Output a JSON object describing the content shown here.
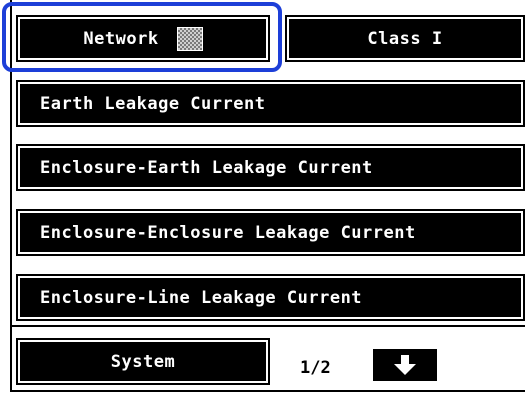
{
  "header": {
    "network_label": "Network",
    "class_label": "Class I"
  },
  "menu": {
    "items": [
      {
        "label": "Earth Leakage Current"
      },
      {
        "label": "Enclosure-Earth Leakage Current"
      },
      {
        "label": "Enclosure-Enclosure Leakage Current"
      },
      {
        "label": "Enclosure-Line Leakage Current"
      }
    ]
  },
  "footer": {
    "system_label": "System",
    "page_indicator": "1/2",
    "next_icon": "arrow-down-icon"
  },
  "colors": {
    "highlight": "#1d3fd8",
    "button_bg": "#000000",
    "button_text": "#ffffff"
  }
}
